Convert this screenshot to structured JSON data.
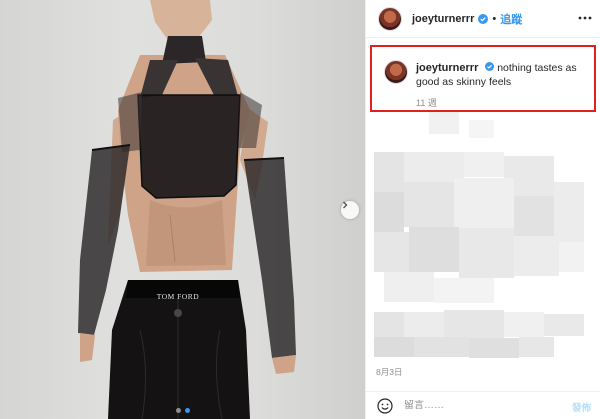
{
  "header": {
    "username": "joeyturnerrr",
    "separator": "•",
    "follow_label": "追蹤",
    "verified_icon": "verified-badge-icon",
    "more_icon": "more-options-icon"
  },
  "caption": {
    "username": "joeyturnerrr",
    "text": "nothing tastes as good as skinny feels",
    "time": "11 週"
  },
  "post_date": "8月3日",
  "comment_bar": {
    "emoji_icon": "smiley-icon",
    "placeholder": "留言……",
    "post_label": "發佈"
  },
  "media": {
    "next_icon": "chevron-right-icon",
    "pagination": {
      "current": 2,
      "total": 2
    },
    "waistband_text": "TOM FORD"
  },
  "colors": {
    "accent": "#3897f0",
    "highlight_border": "#e02020",
    "muted_text": "#8e8e8e",
    "post_button_disabled": "#b2dffc"
  }
}
